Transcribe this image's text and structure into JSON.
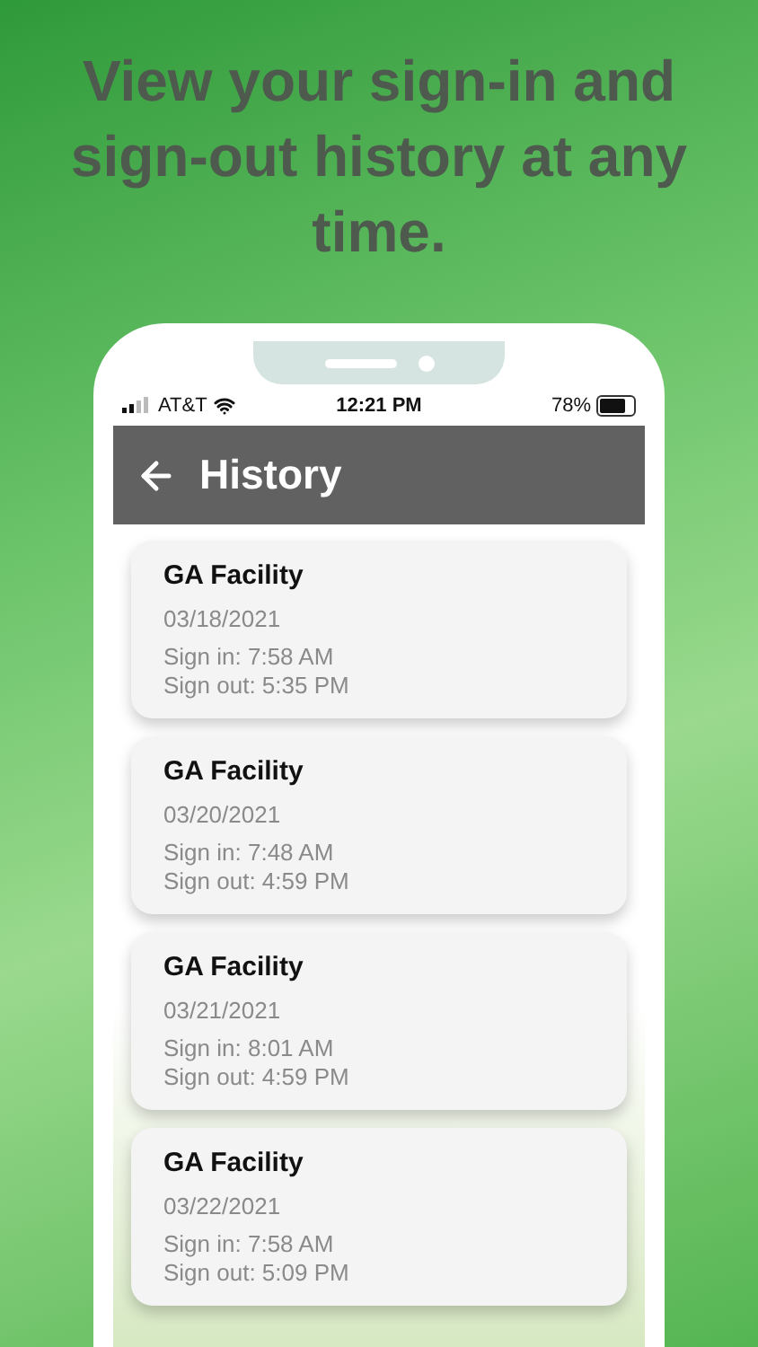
{
  "headline": "View your sign-in and sign-out history at any time.",
  "status_bar": {
    "carrier": "AT&T",
    "time": "12:21 PM",
    "battery": "78%"
  },
  "header": {
    "title": "History"
  },
  "history": [
    {
      "facility": "GA Facility",
      "date": "03/18/2021",
      "sign_in": "Sign in: 7:58 AM",
      "sign_out": "Sign out: 5:35 PM"
    },
    {
      "facility": "GA Facility",
      "date": "03/20/2021",
      "sign_in": "Sign in: 7:48 AM",
      "sign_out": "Sign out: 4:59 PM"
    },
    {
      "facility": "GA Facility",
      "date": "03/21/2021",
      "sign_in": "Sign in: 8:01 AM",
      "sign_out": "Sign out: 4:59 PM"
    },
    {
      "facility": "GA Facility",
      "date": "03/22/2021",
      "sign_in": "Sign in: 7:58 AM",
      "sign_out": "Sign out: 5:09 PM"
    }
  ]
}
